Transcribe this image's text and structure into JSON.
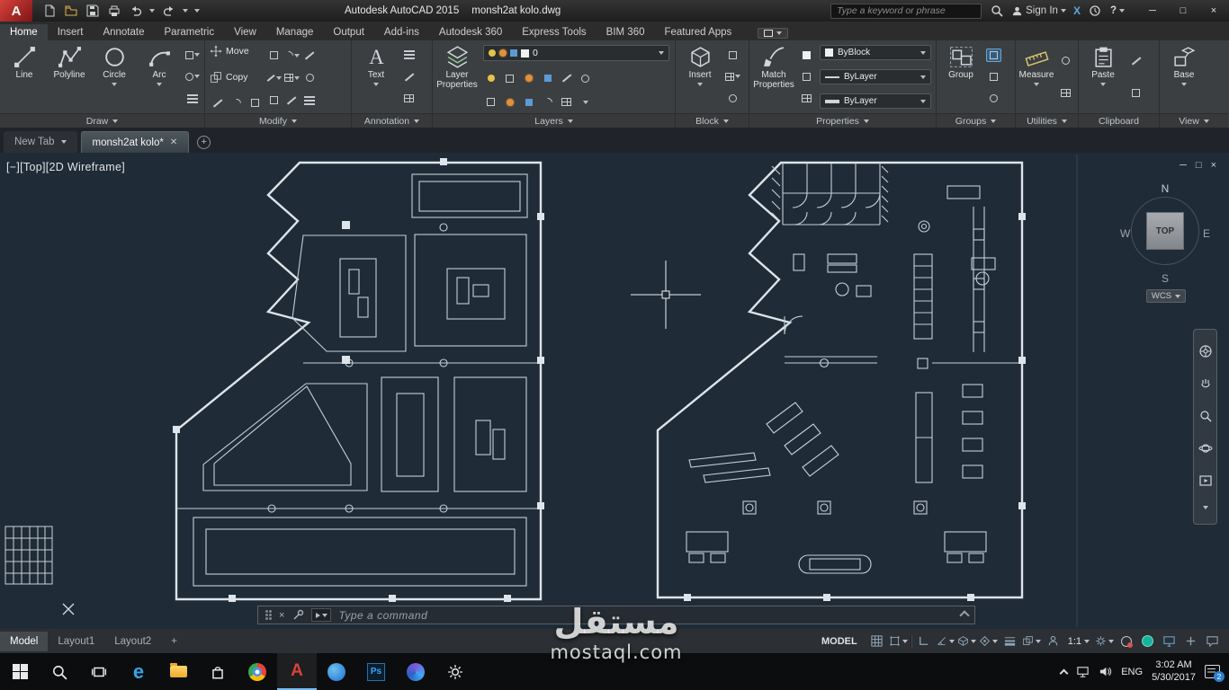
{
  "titlebar": {
    "logo_letter": "A",
    "app_title": "Autodesk AutoCAD 2015",
    "doc_title": "monsh2at kolo.dwg",
    "search_placeholder": "Type a keyword or phrase",
    "sign_in": "Sign In",
    "exchange_glyph": "X",
    "help_glyph": "?",
    "win_min": "─",
    "win_max": "□",
    "win_close": "×"
  },
  "ribbon_tabs": {
    "items": [
      "Home",
      "Insert",
      "Annotate",
      "Parametric",
      "View",
      "Manage",
      "Output",
      "Add-ins",
      "Autodesk 360",
      "Express Tools",
      "BIM 360",
      "Featured Apps"
    ]
  },
  "panels": {
    "draw": {
      "title": "Draw",
      "line": "Line",
      "polyline": "Polyline",
      "circle": "Circle",
      "arc": "Arc"
    },
    "modify": {
      "title": "Modify",
      "move": "Move",
      "copy": "Copy"
    },
    "annotation": {
      "title": "Annotation",
      "text": "Text",
      "icon_glyph": "A"
    },
    "layers": {
      "title": "Layers",
      "layer_properties": "Layer Properties",
      "current_layer": "0"
    },
    "block": {
      "title": "Block",
      "insert": "Insert"
    },
    "properties": {
      "title": "Properties",
      "match": "Match Properties",
      "color": "ByBlock",
      "linetype": "ByLayer",
      "lineweight": "ByLayer"
    },
    "groups": {
      "title": "Groups",
      "group": "Group"
    },
    "utilities": {
      "title": "Utilities",
      "measure": "Measure"
    },
    "clipboard": {
      "title": "Clipboard",
      "paste": "Paste"
    },
    "view": {
      "title": "View",
      "base": "Base"
    }
  },
  "file_tabs": {
    "new_tab": "New Tab",
    "doc_tab": "monsh2at kolo*",
    "close_glyph": "✕",
    "plus_glyph": "+"
  },
  "viewport": {
    "vp_minus": "[−]",
    "vp_view": "[Top]",
    "vp_style": "[2D Wireframe]",
    "win_min": "─",
    "win_restore": "□",
    "win_close": "×",
    "viewcube": {
      "n": "N",
      "e": "E",
      "s": "S",
      "w": "W",
      "top": "TOP",
      "wcs": "WCS"
    }
  },
  "command_line": {
    "prompt": "Type a command"
  },
  "status_bar": {
    "model_tab": "Model",
    "layout1": "Layout1",
    "layout2": "Layout2",
    "plus_glyph": "+",
    "model_label": "MODEL",
    "scale": "1:1"
  },
  "taskbar": {
    "edge_glyph": "e",
    "autocad_glyph": "A",
    "ps_glyph": "Ps",
    "lang": "ENG",
    "time": "3:02 AM",
    "date": "5/30/2017",
    "badge": "2"
  },
  "watermark": {
    "arabic": "مستقل",
    "latin": "mostaql.com"
  }
}
